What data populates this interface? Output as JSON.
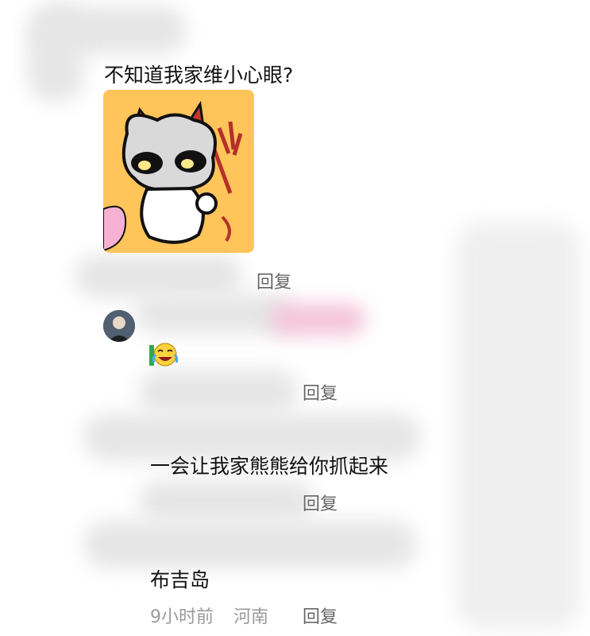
{
  "comments": [
    {
      "text": "不知道我家维小心眼?",
      "reply_label": "回复"
    },
    {
      "reply_label": "回复"
    },
    {
      "text": "一会让我家熊熊给你抓起来",
      "reply_label": "回复"
    },
    {
      "text": "布吉岛",
      "time": "9小时前",
      "location": "河南",
      "reply_label": "回复"
    }
  ],
  "icons": {
    "sticker": "devil-cat-sticker",
    "avatar": "user-avatar",
    "emoji": "laughing-crying-emoji"
  },
  "colors": {
    "text": "#111111",
    "meta": "#9a9a9a",
    "reply": "#666666",
    "sticker_bg": "#ffc45a"
  }
}
